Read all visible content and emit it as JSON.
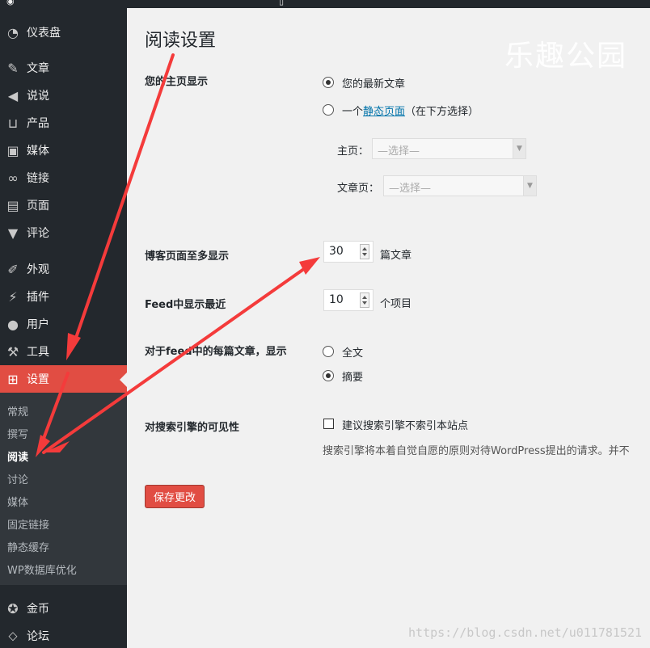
{
  "sidebar": {
    "items": [
      {
        "icon": "dashboard-icon",
        "label": "仪表盘"
      },
      {
        "icon": "pin-icon",
        "label": "文章"
      },
      {
        "icon": "megaphone-icon",
        "label": "说说"
      },
      {
        "icon": "cart-icon",
        "label": "产品"
      },
      {
        "icon": "media-icon",
        "label": "媒体"
      },
      {
        "icon": "link-icon",
        "label": "链接"
      },
      {
        "icon": "page-icon",
        "label": "页面"
      },
      {
        "icon": "comment-icon",
        "label": "评论"
      },
      {
        "icon": "brush-icon",
        "label": "外观"
      },
      {
        "icon": "plugin-icon",
        "label": "插件"
      },
      {
        "icon": "user-icon",
        "label": "用户"
      },
      {
        "icon": "wrench-icon",
        "label": "工具"
      },
      {
        "icon": "settings-icon",
        "label": "设置"
      },
      {
        "icon": "coin-icon",
        "label": "金币"
      },
      {
        "icon": "forum-icon",
        "label": "论坛"
      }
    ],
    "submenu": [
      {
        "label": "常规"
      },
      {
        "label": "撰写"
      },
      {
        "label": "阅读"
      },
      {
        "label": "讨论"
      },
      {
        "label": "媒体"
      },
      {
        "label": "固定链接"
      },
      {
        "label": "静态缓存"
      },
      {
        "label": "WP数据库优化"
      }
    ]
  },
  "page": {
    "title": "阅读设置",
    "homepage": {
      "label": "您的主页显示",
      "option_latest": "您的最新文章",
      "option_static_prefix": "一个",
      "option_static_link": "静态页面",
      "option_static_suffix": "（在下方选择）",
      "front_label": "主页：",
      "front_value": "—选择—",
      "posts_label": "文章页：",
      "posts_value": "—选择—"
    },
    "per_page": {
      "label": "博客页面至多显示",
      "value": "30",
      "unit": "篇文章"
    },
    "feed_count": {
      "label": "Feed中显示最近",
      "value": "10",
      "unit": "个项目"
    },
    "feed_mode": {
      "label": "对于feed中的每篇文章，显示",
      "option_full": "全文",
      "option_summary": "摘要"
    },
    "search": {
      "label": "对搜索引擎的可见性",
      "checkbox_label": "建议搜索引擎不索引本站点",
      "description": "搜索引擎将本着自觉自愿的原则对待WordPress提出的请求。并不"
    },
    "save_button": "保存更改"
  },
  "watermark": "乐趣公园",
  "url_watermark": "https://blog.csdn.net/u011781521",
  "colors": {
    "accent": "#e14d43",
    "sidebar": "#23282d",
    "submenu": "#32373c",
    "link": "#0073aa",
    "arrow": "#f43b3b"
  }
}
